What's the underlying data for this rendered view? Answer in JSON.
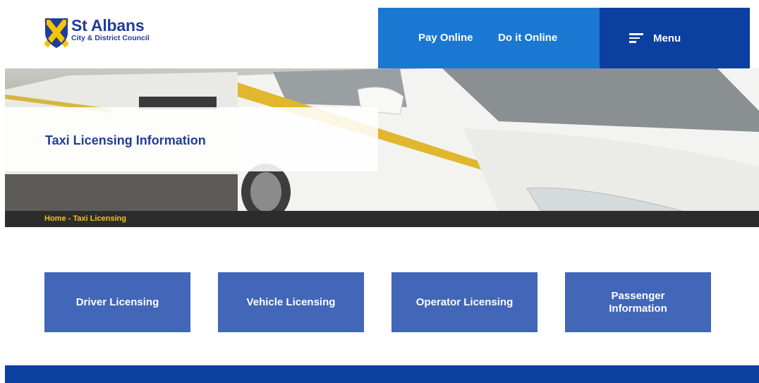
{
  "header": {
    "logo_title": "St Albans",
    "logo_subtitle": "City & District Council",
    "pay_online": "Pay Online",
    "do_it_online": "Do it Online",
    "menu_label": "Menu"
  },
  "hero": {
    "title": "Taxi Licensing Information"
  },
  "breadcrumb": {
    "home": "Home",
    "separator": " - ",
    "current": "Taxi Licensing"
  },
  "tiles": [
    {
      "label": "Driver Licensing"
    },
    {
      "label": "Vehicle Licensing"
    },
    {
      "label": "Operator Licensing"
    },
    {
      "label": "Passenger Information"
    }
  ],
  "colors": {
    "brand_blue": "#1f3d99",
    "top_bar_blue": "#1a78d2",
    "menu_dark_blue": "#0b3fa0",
    "tile_blue": "#4266b8",
    "breadcrumb_yellow": "#f0c419"
  },
  "icons": {
    "logo": "council-crest-icon",
    "menu": "hamburger-menu-icon"
  }
}
